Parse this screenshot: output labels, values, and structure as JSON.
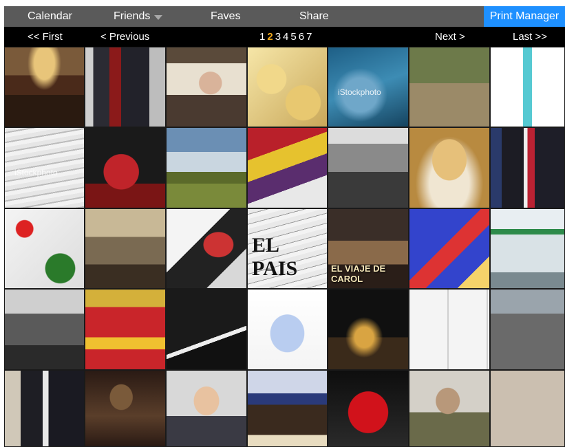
{
  "nav": {
    "calendar": "Calendar",
    "friends": "Friends",
    "faves": "Faves",
    "share": "Share",
    "print_manager": "Print Manager"
  },
  "pager": {
    "first": "<< First",
    "previous": "< Previous",
    "pages": [
      "1",
      "2",
      "3",
      "4",
      "5",
      "6",
      "7"
    ],
    "current_page": "2",
    "next": "Next >",
    "last": "Last >>"
  },
  "colors": {
    "topbar": "#5a5a5a",
    "pager": "#000000",
    "print_manager": "#1e90ff",
    "current_page": "#f2a91d"
  },
  "tiles": [
    {
      "icon": "parliament-chamber-photo"
    },
    {
      "icon": "politicians-walking-photo"
    },
    {
      "icon": "old-man-flat-cap-photo"
    },
    {
      "icon": "spanish-omelette-photo"
    },
    {
      "icon": "blue-texture-stockphoto",
      "watermark": "iStockphoto"
    },
    {
      "icon": "old-woman-and-cow-photo"
    },
    {
      "icon": "test-tube-photo"
    },
    {
      "icon": "newspapers-stack-photo",
      "watermark": "iStockphoto"
    },
    {
      "icon": "dancer-red-dress-photo"
    },
    {
      "icon": "field-landscape-photo"
    },
    {
      "icon": "republican-flag-photo"
    },
    {
      "icon": "historic-soldiers-photo"
    },
    {
      "icon": "virgin-statue-photo"
    },
    {
      "icon": "leaders-handshake-photo"
    },
    {
      "icon": "drugs-illustration"
    },
    {
      "icon": "procession-float-painting"
    },
    {
      "icon": "woman-and-man-photo"
    },
    {
      "icon": "el-pais-newspaper-photo",
      "text": "EL PAIS"
    },
    {
      "icon": "movie-poster-photo",
      "caption": "EL VIAJE DE CAROL"
    },
    {
      "icon": "spain-map"
    },
    {
      "icon": "department-store-photo"
    },
    {
      "icon": "historic-salute-photo"
    },
    {
      "icon": "coat-of-arms-spain"
    },
    {
      "icon": "cocaine-line-photo"
    },
    {
      "icon": "cartoon-rabbit-illustration"
    },
    {
      "icon": "night-procession-photo"
    },
    {
      "icon": "newspaper-front-pages"
    },
    {
      "icon": "traffic-jam-photo"
    },
    {
      "icon": "leaders-chatting-photo"
    },
    {
      "icon": "christ-statue-photo"
    },
    {
      "icon": "smiling-judge-photo"
    },
    {
      "icon": "treaty-signing-photo"
    },
    {
      "icon": "red-hood-penitent-photo"
    },
    {
      "icon": "general-portrait-photo"
    },
    {
      "icon": "bullfight-photo"
    }
  ]
}
